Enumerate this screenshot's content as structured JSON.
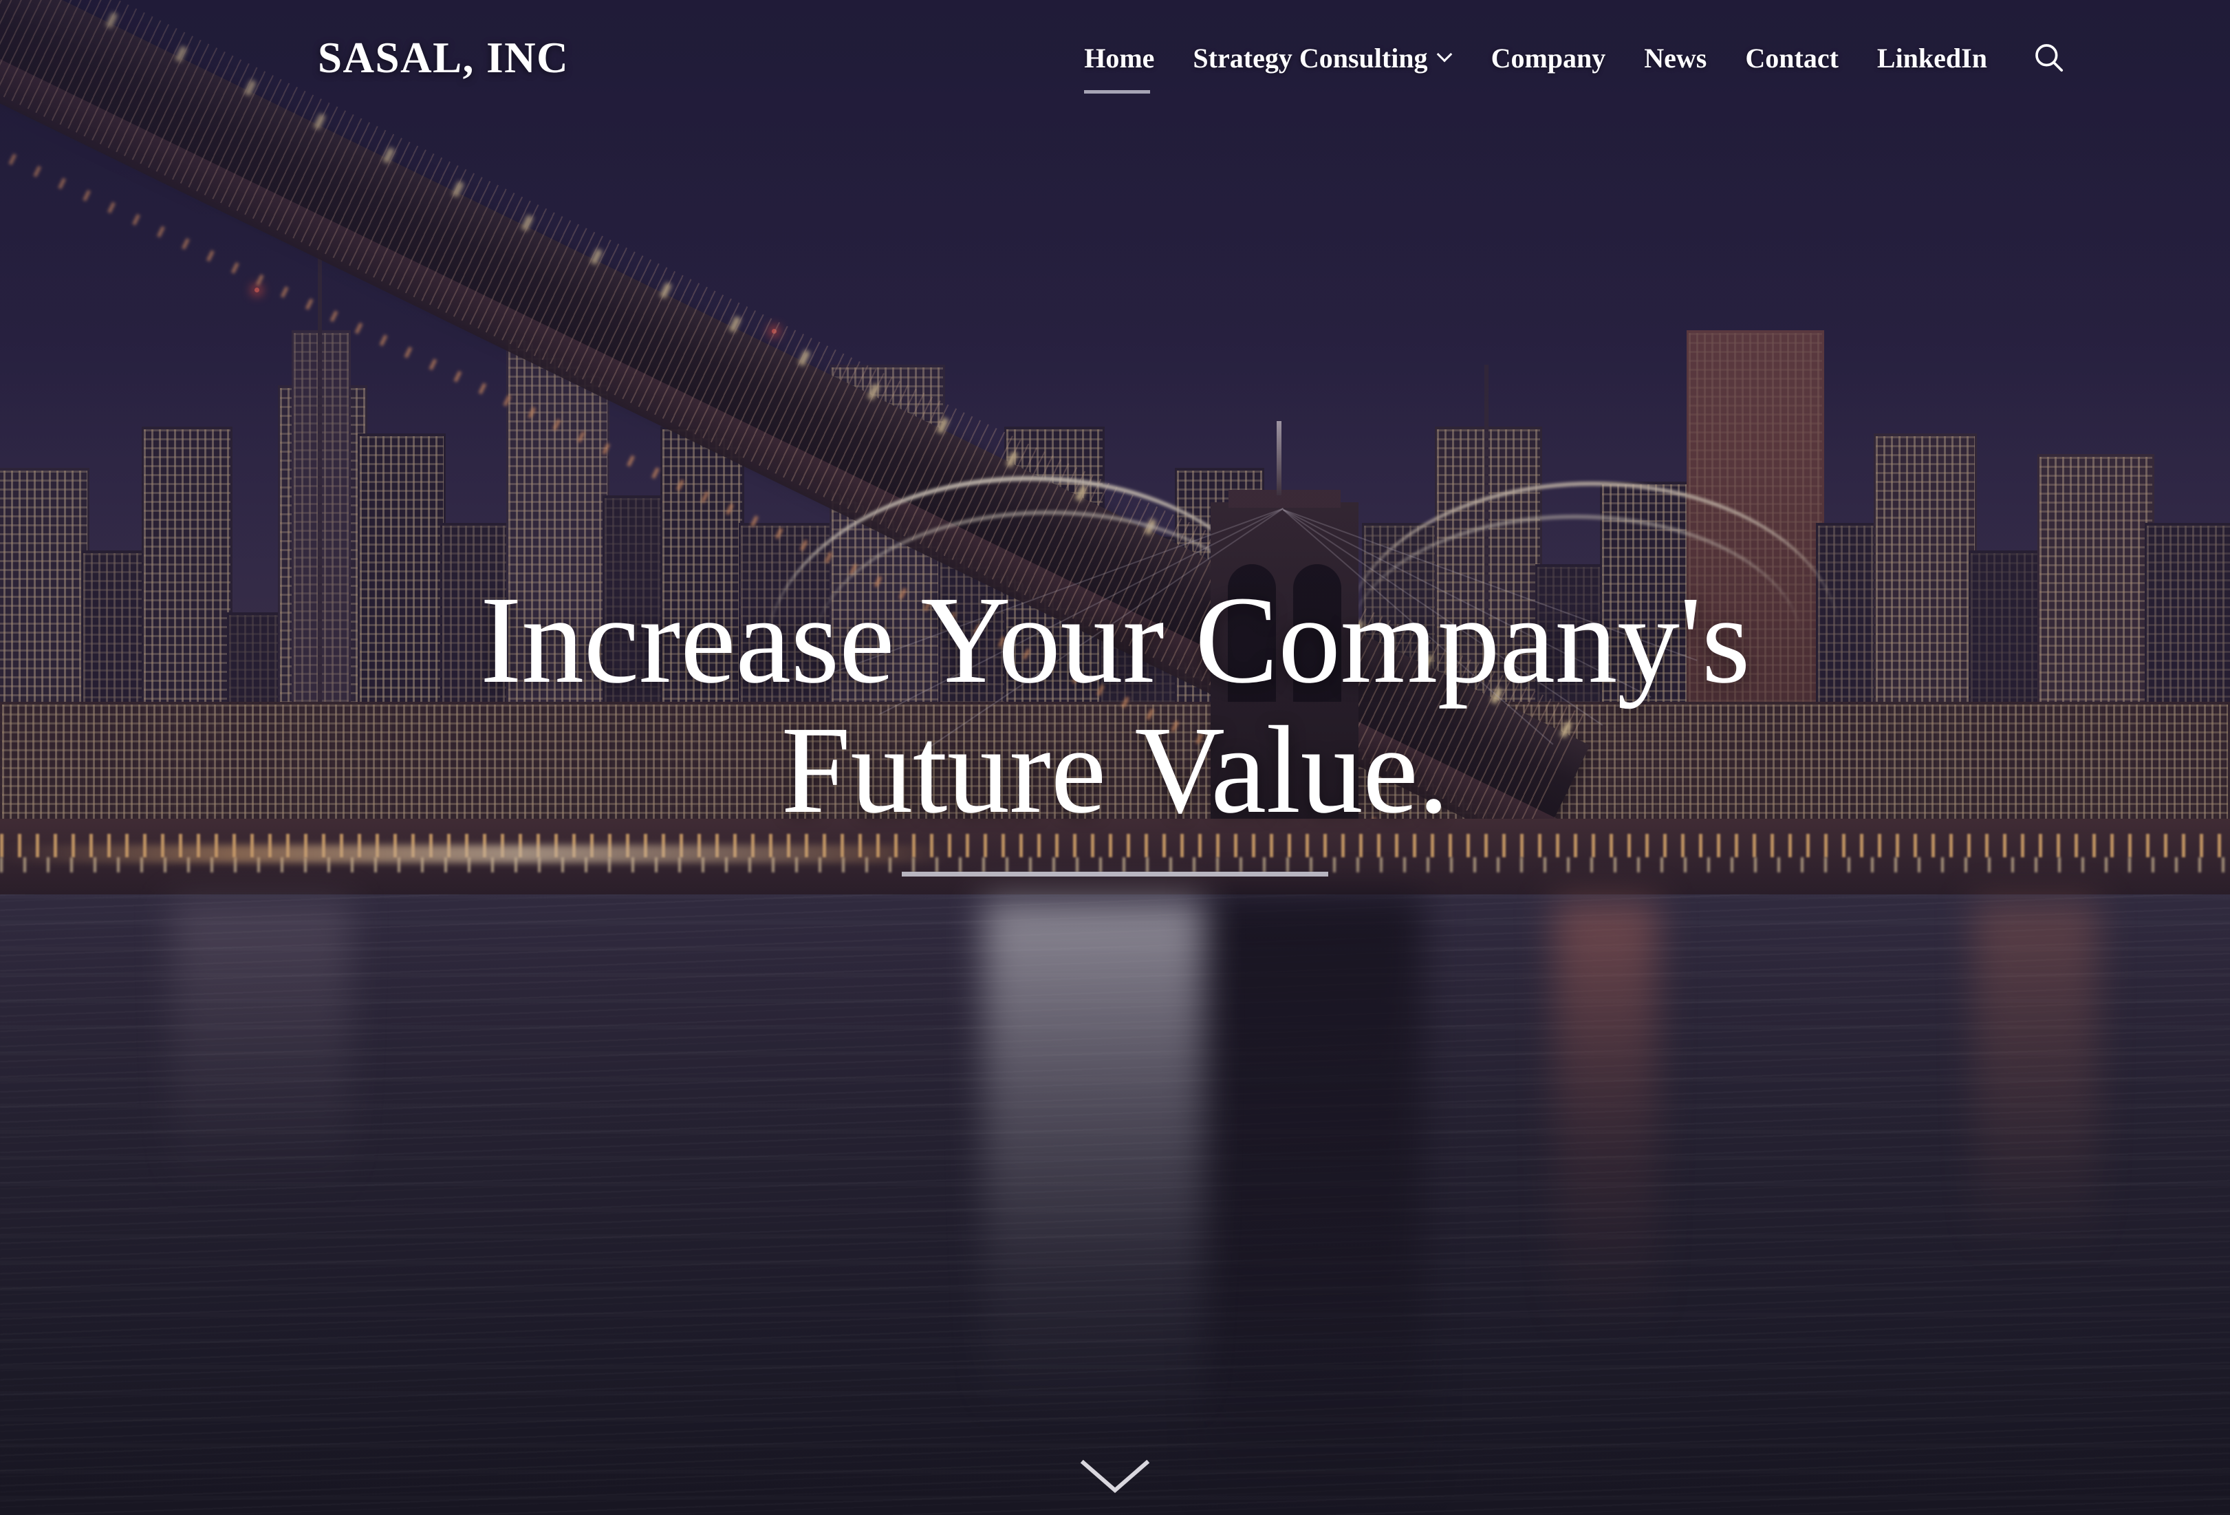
{
  "site": {
    "logo_text": "SASAL, INC",
    "accent_color": "#ffffff",
    "background_theme_color": "#2b2446"
  },
  "header": {
    "nav": [
      {
        "label": "Home",
        "active": true,
        "has_dropdown": false
      },
      {
        "label": "Strategy Consulting",
        "active": false,
        "has_dropdown": true,
        "chevron_icon": "chevron-down-icon"
      },
      {
        "label": "Company",
        "active": false,
        "has_dropdown": false
      },
      {
        "label": "News",
        "active": false,
        "has_dropdown": false
      },
      {
        "label": "Contact",
        "active": false,
        "has_dropdown": false
      },
      {
        "label": "LinkedIn",
        "active": false,
        "has_dropdown": false
      }
    ],
    "search": {
      "icon": "search-icon",
      "label": "Search"
    }
  },
  "hero": {
    "title_line1": "Increase Your Company's",
    "title_line2": "Future Value.",
    "divider_color": "#c4c2cd",
    "scroll_cue_icon": "chevron-down-icon",
    "background_image_description": "Brooklyn Bridge at night over the East River with the lower Manhattan skyline"
  }
}
